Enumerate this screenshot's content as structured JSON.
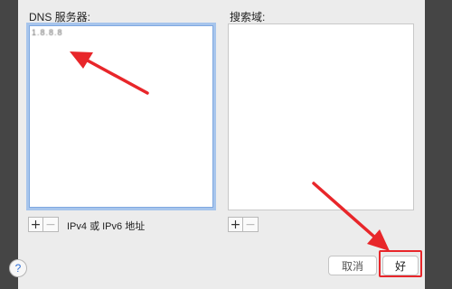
{
  "dns": {
    "label": "DNS 服务器:",
    "entry": "1.8.8.8",
    "add_symbol": "+",
    "remove_symbol": "−",
    "hint": "IPv4 或 IPv6 地址"
  },
  "search": {
    "label": "搜索域:",
    "add_symbol": "+",
    "remove_symbol": "−"
  },
  "footer": {
    "help_symbol": "?",
    "cancel_label": "取消",
    "ok_label": "好"
  },
  "colors": {
    "annotation": "#e8262a",
    "focus_ring": "#a7c5ec"
  },
  "icons": [
    "question-mark-icon",
    "plus-icon",
    "minus-icon",
    "arrow-annotation"
  ]
}
